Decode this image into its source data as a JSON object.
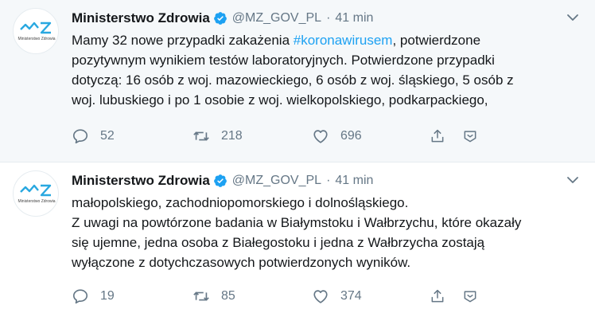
{
  "colors": {
    "accent": "#1da1f2",
    "muted": "#657786",
    "text": "#14171a",
    "highlight_bg": "#f5f8fa",
    "logo_blue": "#29a8e0"
  },
  "tweets": [
    {
      "author": {
        "name": "Ministerstwo Zdrowia",
        "handle": "@MZ_GOV_PL",
        "verified": true,
        "avatar_icon": "ministry-of-health-logo",
        "avatar_caption": "Ministerstwo Zdrowia"
      },
      "separator": "·",
      "time": "41 min",
      "text_lines": [
        {
          "before": "Mamy 32 nowe przypadki zakażenia ",
          "hashtag": "#koronawirusem",
          "after": ", potwierdzone"
        },
        {
          "text": "pozytywnym wynikiem testów laboratoryjnych. Potwierdzone przypadki"
        },
        {
          "text": "dotyczą: 16 osób z woj. mazowieckiego, 6 osób z woj. śląskiego, 5 osób z"
        },
        {
          "text": "woj. lubuskiego i po 1 osobie z woj. wielkopolskiego, podkarpackiego,"
        }
      ],
      "stats": {
        "replies": "52",
        "retweets": "218",
        "likes": "696"
      }
    },
    {
      "author": {
        "name": "Ministerstwo Zdrowia",
        "handle": "@MZ_GOV_PL",
        "verified": true,
        "avatar_icon": "ministry-of-health-logo",
        "avatar_caption": "Ministerstwo Zdrowia"
      },
      "separator": "·",
      "time": "41 min",
      "text_lines": [
        {
          "text": "małopolskiego, zachodniopomorskiego i dolnośląskiego."
        },
        {
          "text": "Z uwagi na powtórzone badania w Białymstoku i Wałbrzychu, które okazały"
        },
        {
          "text": "się ujemne, jedna osoba z Białegostoku i jedna z Wałbrzycha zostają"
        },
        {
          "text": "wyłączone z dotychczasowych potwierdzonych wyników."
        }
      ],
      "stats": {
        "replies": "19",
        "retweets": "85",
        "likes": "374"
      }
    }
  ],
  "icons": {
    "caret": "chevron-down-icon",
    "reply": "reply-icon",
    "retweet": "retweet-icon",
    "like": "heart-icon",
    "share": "share-icon",
    "dm": "direct-message-icon",
    "verified": "verified-badge-icon"
  }
}
